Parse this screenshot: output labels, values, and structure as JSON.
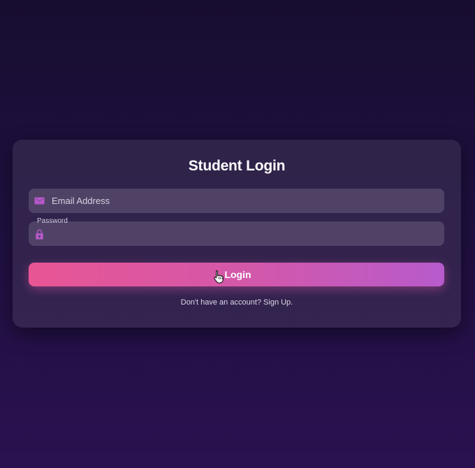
{
  "card": {
    "title": "Student Login"
  },
  "form": {
    "email": {
      "placeholder": "Email Address",
      "icon": "envelope-icon"
    },
    "password": {
      "label": "Password",
      "icon": "lock-icon",
      "value": ""
    },
    "submit_label": "Login",
    "signup_text": "Don't have an account? Sign Up."
  },
  "colors": {
    "accent_start": "#e85594",
    "accent_end": "#b75bcc",
    "icon": "#b458c8"
  }
}
